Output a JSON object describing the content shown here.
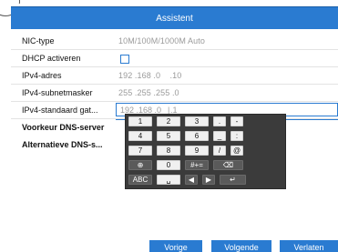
{
  "title": "Assistent",
  "fields": {
    "nic_type": {
      "label": "NIC-type",
      "value": "10M/100M/1000M Auto"
    },
    "dhcp": {
      "label": "DHCP activeren"
    },
    "ipv4_address": {
      "label": "IPv4-adres",
      "value": "192 .168 .0    .10"
    },
    "ipv4_subnet": {
      "label": "IPv4-subnetmasker",
      "value": "255 .255 .255 .0"
    },
    "ipv4_gateway": {
      "label": "IPv4-standaard gat...",
      "value": "192 .168 .0    .1",
      "caret": "|"
    },
    "preferred_dns": {
      "label": "Voorkeur DNS-server"
    },
    "alternate_dns": {
      "label": "Alternatieve DNS-s..."
    }
  },
  "keyboard": {
    "row1": [
      "1",
      "2",
      "3",
      ".",
      "-"
    ],
    "row2": [
      "4",
      "5",
      "6",
      "_",
      ":"
    ],
    "row3": [
      "7",
      "8",
      "9",
      "/",
      "@"
    ],
    "row4": {
      "globe": "⊕",
      "zero": "0",
      "shift": "#+=",
      "backspace": "⌫"
    },
    "row5": {
      "abc": "ABC",
      "space": "␣",
      "left": "◀",
      "right": "▶",
      "enter": "↵"
    }
  },
  "buttons": {
    "prev": "Vorige",
    "next": "Volgende",
    "exit": "Verlaten"
  },
  "colors": {
    "accent": "#2a7bd1",
    "keyboard_bg": "#3b3b3b"
  }
}
